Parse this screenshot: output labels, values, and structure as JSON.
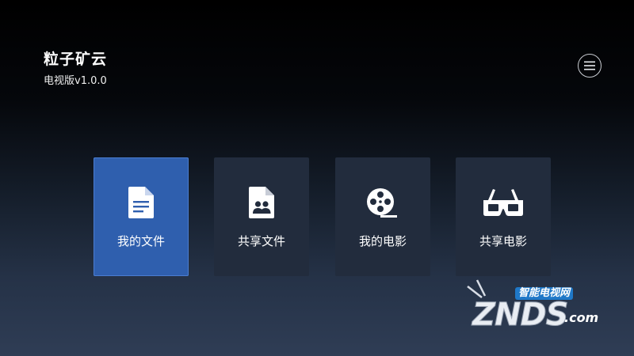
{
  "header": {
    "title": "粒子矿云",
    "subtitle": "电视版v1.0.0"
  },
  "menu": {
    "icon": "menu-icon"
  },
  "tiles": [
    {
      "label": "我的文件",
      "icon": "document-icon",
      "active": true
    },
    {
      "label": "共享文件",
      "icon": "shared-file-icon",
      "active": false
    },
    {
      "label": "我的电影",
      "icon": "film-reel-icon",
      "active": false
    },
    {
      "label": "共享电影",
      "icon": "vr-glasses-icon",
      "active": false
    }
  ],
  "watermark": {
    "top_text": "智能电视网",
    "main_text": "ZNDS",
    "suffix": ".com"
  },
  "colors": {
    "active_tile": "#2f5fae",
    "tile": "#222c3d",
    "background_top": "#000000",
    "background_bottom": "#2f3d55"
  }
}
